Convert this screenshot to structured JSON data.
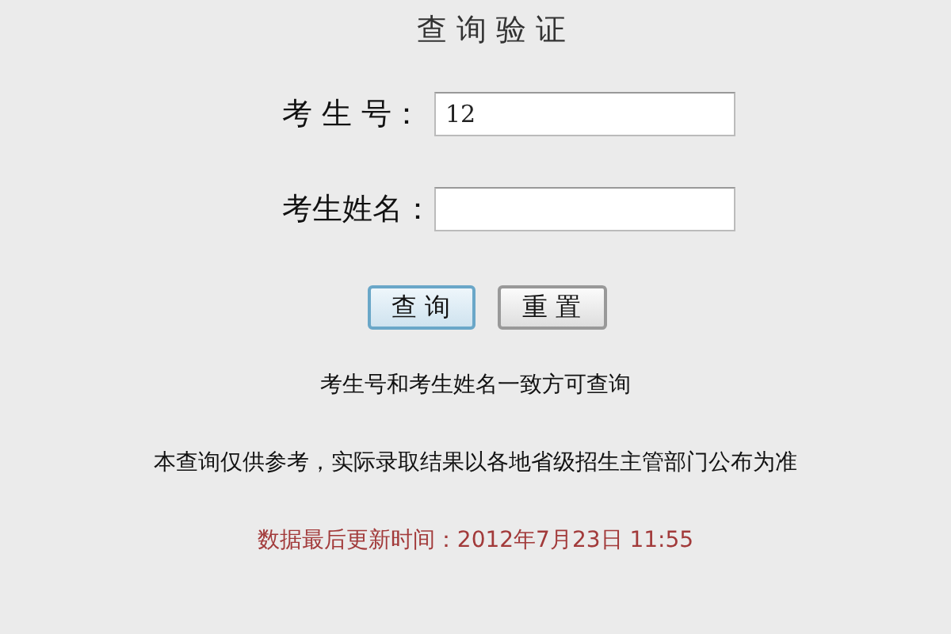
{
  "title": "查 询 验 证",
  "fields": [
    {
      "label": "考 生 号：",
      "value": "12"
    },
    {
      "label": "考生姓名："
    }
  ],
  "buttons": [
    {
      "label": "查 询",
      "selected": true
    },
    {
      "label": "重 置",
      "selected": false
    }
  ],
  "notes": [
    {
      "text": "考生号和考生姓名一致方可查询",
      "kind": "plain"
    },
    {
      "text": "本查询仅供参考，实际录取结果以各地省级招生主管部门公布为准",
      "kind": "plain"
    },
    {
      "text": "数据最后更新时间：2012年7月23日 11:55",
      "kind": "update"
    }
  ]
}
